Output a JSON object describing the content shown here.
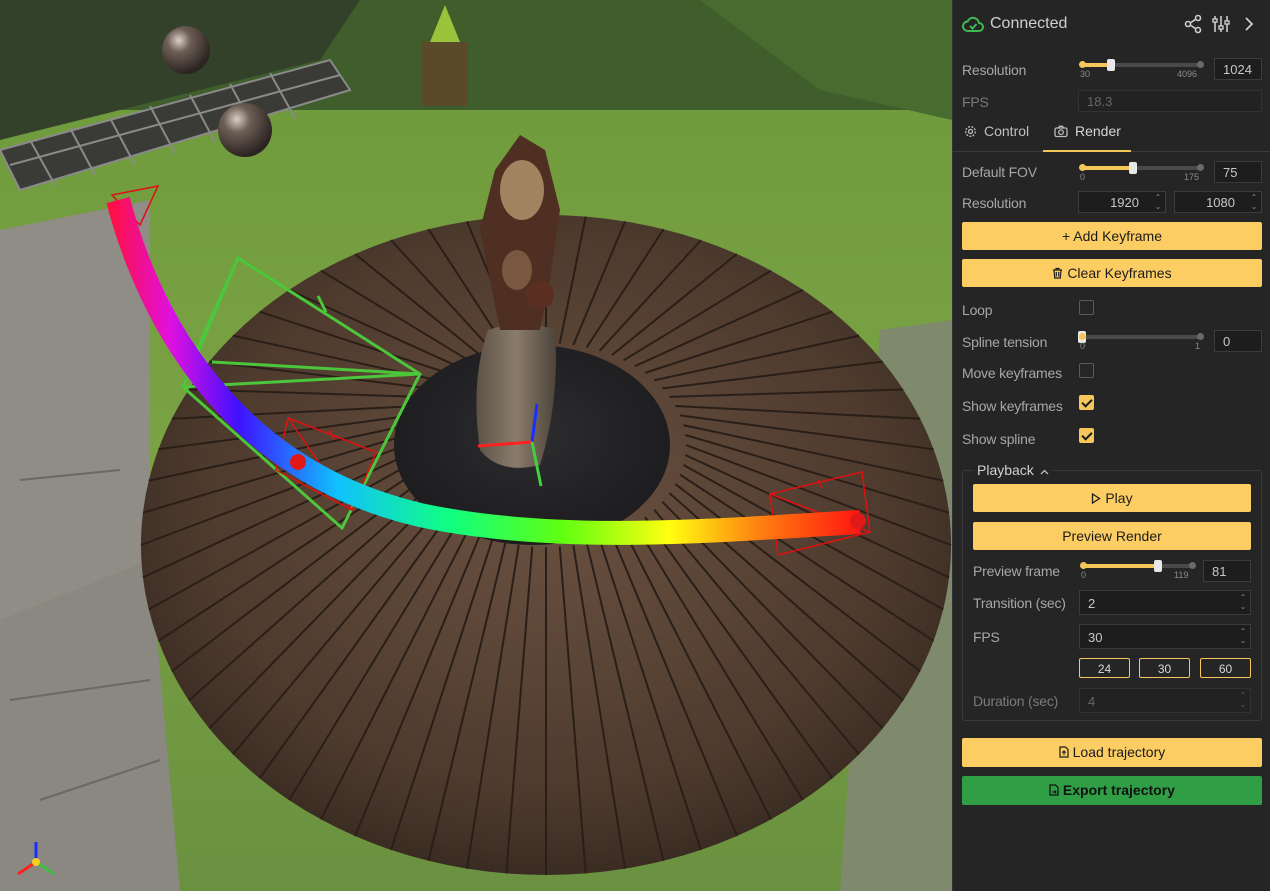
{
  "header": {
    "status": "Connected",
    "icons": [
      "cloud-check-icon",
      "share-icon",
      "sliders-icon",
      "chevron-right-icon"
    ]
  },
  "top": {
    "resolution_label": "Resolution",
    "resolution_min": "30",
    "resolution_max": "4096",
    "resolution_value": "1024",
    "resolution_fraction": 0.245,
    "fps_label": "FPS",
    "fps_value": "18.3"
  },
  "tabs": [
    {
      "label": "Control"
    },
    {
      "label": "Render"
    }
  ],
  "render": {
    "fov_label": "Default FOV",
    "fov_min": "0",
    "fov_max": "175",
    "fov_value": "75",
    "fov_fraction": 0.43,
    "resolution_label": "Resolution",
    "width": "1920",
    "height": "1080",
    "add_keyframe": "Add Keyframe",
    "clear_keyframes": "Clear Keyframes",
    "loop_label": "Loop",
    "loop_checked": false,
    "tension_label": "Spline tension",
    "tension_min": "0",
    "tension_max": "1",
    "tension_value": "0",
    "tension_fraction": 0.0,
    "move_keyframes_label": "Move keyframes",
    "move_keyframes_checked": false,
    "show_keyframes_label": "Show keyframes",
    "show_keyframes_checked": true,
    "show_spline_label": "Show spline",
    "show_spline_checked": true
  },
  "playback": {
    "title": "Playback",
    "play": "Play",
    "preview_render": "Preview Render",
    "preview_frame_label": "Preview frame",
    "preview_min": "0",
    "preview_max": "119",
    "preview_value": "81",
    "preview_fraction": 0.68,
    "transition_label": "Transition (sec)",
    "transition_value": "2",
    "fps_label": "FPS",
    "fps_value": "30",
    "fps_presets": [
      "24",
      "30",
      "60"
    ],
    "duration_label": "Duration (sec)",
    "duration_value": "4"
  },
  "actions": {
    "load": "Load trajectory",
    "export": "Export trajectory"
  },
  "colors": {
    "accent": "#fccd63",
    "export_green": "#2f9e44",
    "connected_green": "#3fb950"
  }
}
